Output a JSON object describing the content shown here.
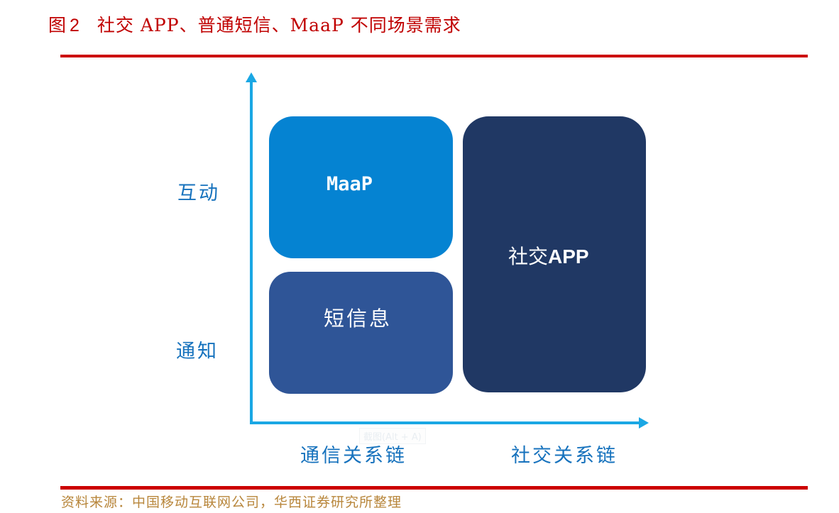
{
  "figure": {
    "number_label": "图",
    "number": "2",
    "title": "社交 APP、普通短信、MaaP 不同场景需求"
  },
  "colors": {
    "title_red": "#C00000",
    "rule_red": "#CC0000",
    "axis_blue": "#1AA7E4",
    "axis_label_blue": "#1672BD",
    "source_gold": "#B8863B",
    "maap_fill": "#0583D2",
    "sms_fill": "#2F5597",
    "social_fill": "#203864"
  },
  "diagram": {
    "y_axis": {
      "labels": [
        "互动",
        "通知"
      ]
    },
    "x_axis": {
      "labels": [
        "通信关系链",
        "社交关系链"
      ]
    },
    "boxes": [
      {
        "id": "maap",
        "label": "MaaP",
        "y_category": "互动",
        "x_category": "通信关系链"
      },
      {
        "id": "sms",
        "label": "短信息",
        "y_category": "通知",
        "x_category": "通信关系链"
      },
      {
        "id": "social",
        "label_cjk": "社交",
        "label_latin": "APP",
        "y_category": "互动+通知",
        "x_category": "社交关系链"
      }
    ]
  },
  "tooltip_ghost": "截图(Alt + A)",
  "source": "资料来源：中国移动互联网公司，华西证券研究所整理"
}
